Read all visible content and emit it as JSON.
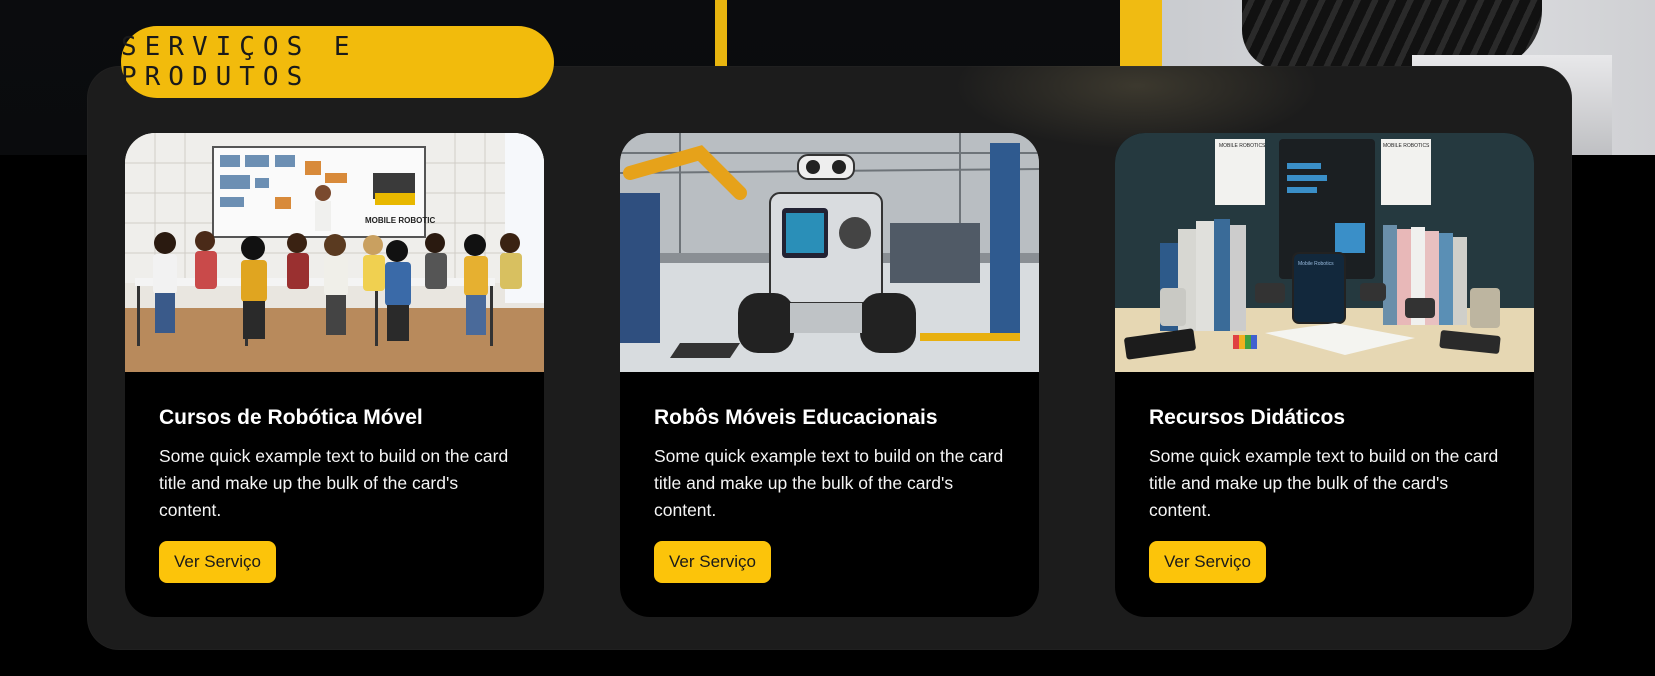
{
  "section": {
    "title": "SERVIÇOS E PRODUTOS"
  },
  "cards": [
    {
      "title": "Cursos de Robótica Móvel",
      "text": "Some quick example text to build on the card title and make up the bulk of the card's content.",
      "button": "Ver Serviço",
      "image_board_label": "MOBILE ROBOTIC"
    },
    {
      "title": "Robôs Móveis Educacionais",
      "text": "Some quick example text to build on the card title and make up the bulk of the card's content.",
      "button": "Ver Serviço"
    },
    {
      "title": "Recursos Didáticos",
      "text": "Some quick example text to build on the card title and make up the bulk of the card's content.",
      "button": "Ver Serviço",
      "image_poster_labels": [
        "MOBILE ROBOTICS",
        "Mobile Robotics",
        "MOBILE ROBOTICS"
      ]
    }
  ],
  "colors": {
    "accent": "#f2bb0c",
    "button": "#fcc40a",
    "panel": "#1c1c1c",
    "card": "#000000"
  }
}
